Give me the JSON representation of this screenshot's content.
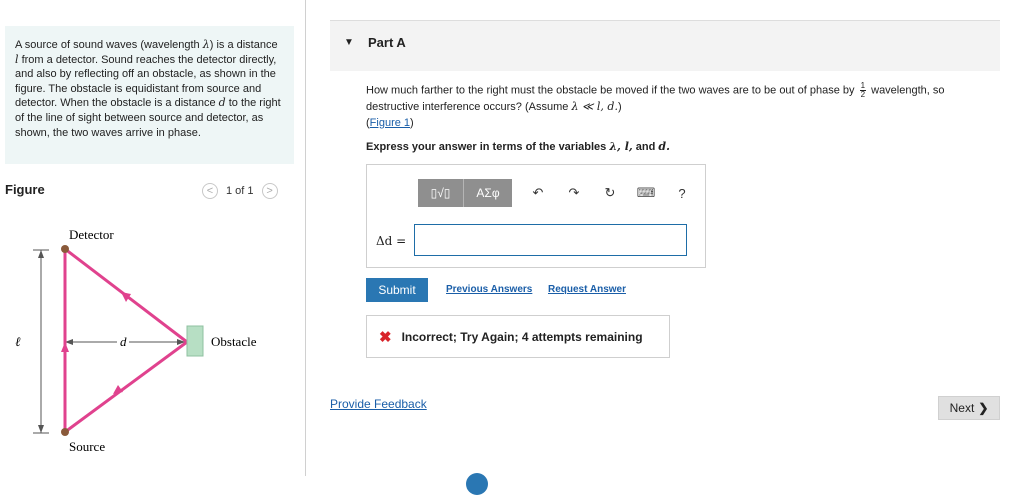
{
  "problem": {
    "text_html": "A source of sound waves (wavelength <i>λ</i>) is a distance <i>l</i> from a detector. Sound reaches the detector directly, and also by reflecting off an obstacle, as shown in the figure. The obstacle is equidistant from source and detector. When the obstacle is a distance <i>d</i> to the right of the line of sight between source and detector, as shown, the two waves arrive in phase."
  },
  "figure": {
    "title": "Figure",
    "pager": {
      "prev": "<",
      "count": "1 of 1",
      "next": ">"
    },
    "labels": {
      "detector": "Detector",
      "source": "Source",
      "obstacle": "Obstacle",
      "l": "ℓ",
      "d": "d"
    },
    "colors": {
      "ray": "#e0428e",
      "obstacle_fill": "#b7dfc4",
      "obstacle_stroke": "#8fc0a0",
      "endpoint": "#8a5a3a"
    }
  },
  "part": {
    "title": "Part A",
    "question_main": "How much farther to the right must the obstacle be moved if the two waves are to be out of phase by",
    "fraction": {
      "num": "1",
      "den": "2"
    },
    "question_tail": "wavelength, so destructive interference occurs? (Assume",
    "assume_expr": "λ ≪ l, d.",
    "figure_link": "Figure 1",
    "express_prefix": "Express your answer in terms of the variables",
    "express_vars": "λ, l,",
    "express_and": "and",
    "express_last": "d."
  },
  "toolbar": {
    "templates_label": "▯√▯",
    "symbols_label": "ΑΣφ",
    "undo": "↶",
    "redo": "↷",
    "reset": "↻",
    "keyboard": "⌨",
    "help": "?"
  },
  "answer": {
    "label": "Δd =",
    "value": ""
  },
  "actions": {
    "submit": "Submit",
    "previous_answers": "Previous Answers",
    "request_answer": "Request Answer"
  },
  "feedback": {
    "icon": "✖",
    "message": "Incorrect; Try Again; 4 attempts remaining"
  },
  "footer": {
    "provide_feedback": "Provide Feedback",
    "next": "Next",
    "next_chevron": "❯"
  }
}
